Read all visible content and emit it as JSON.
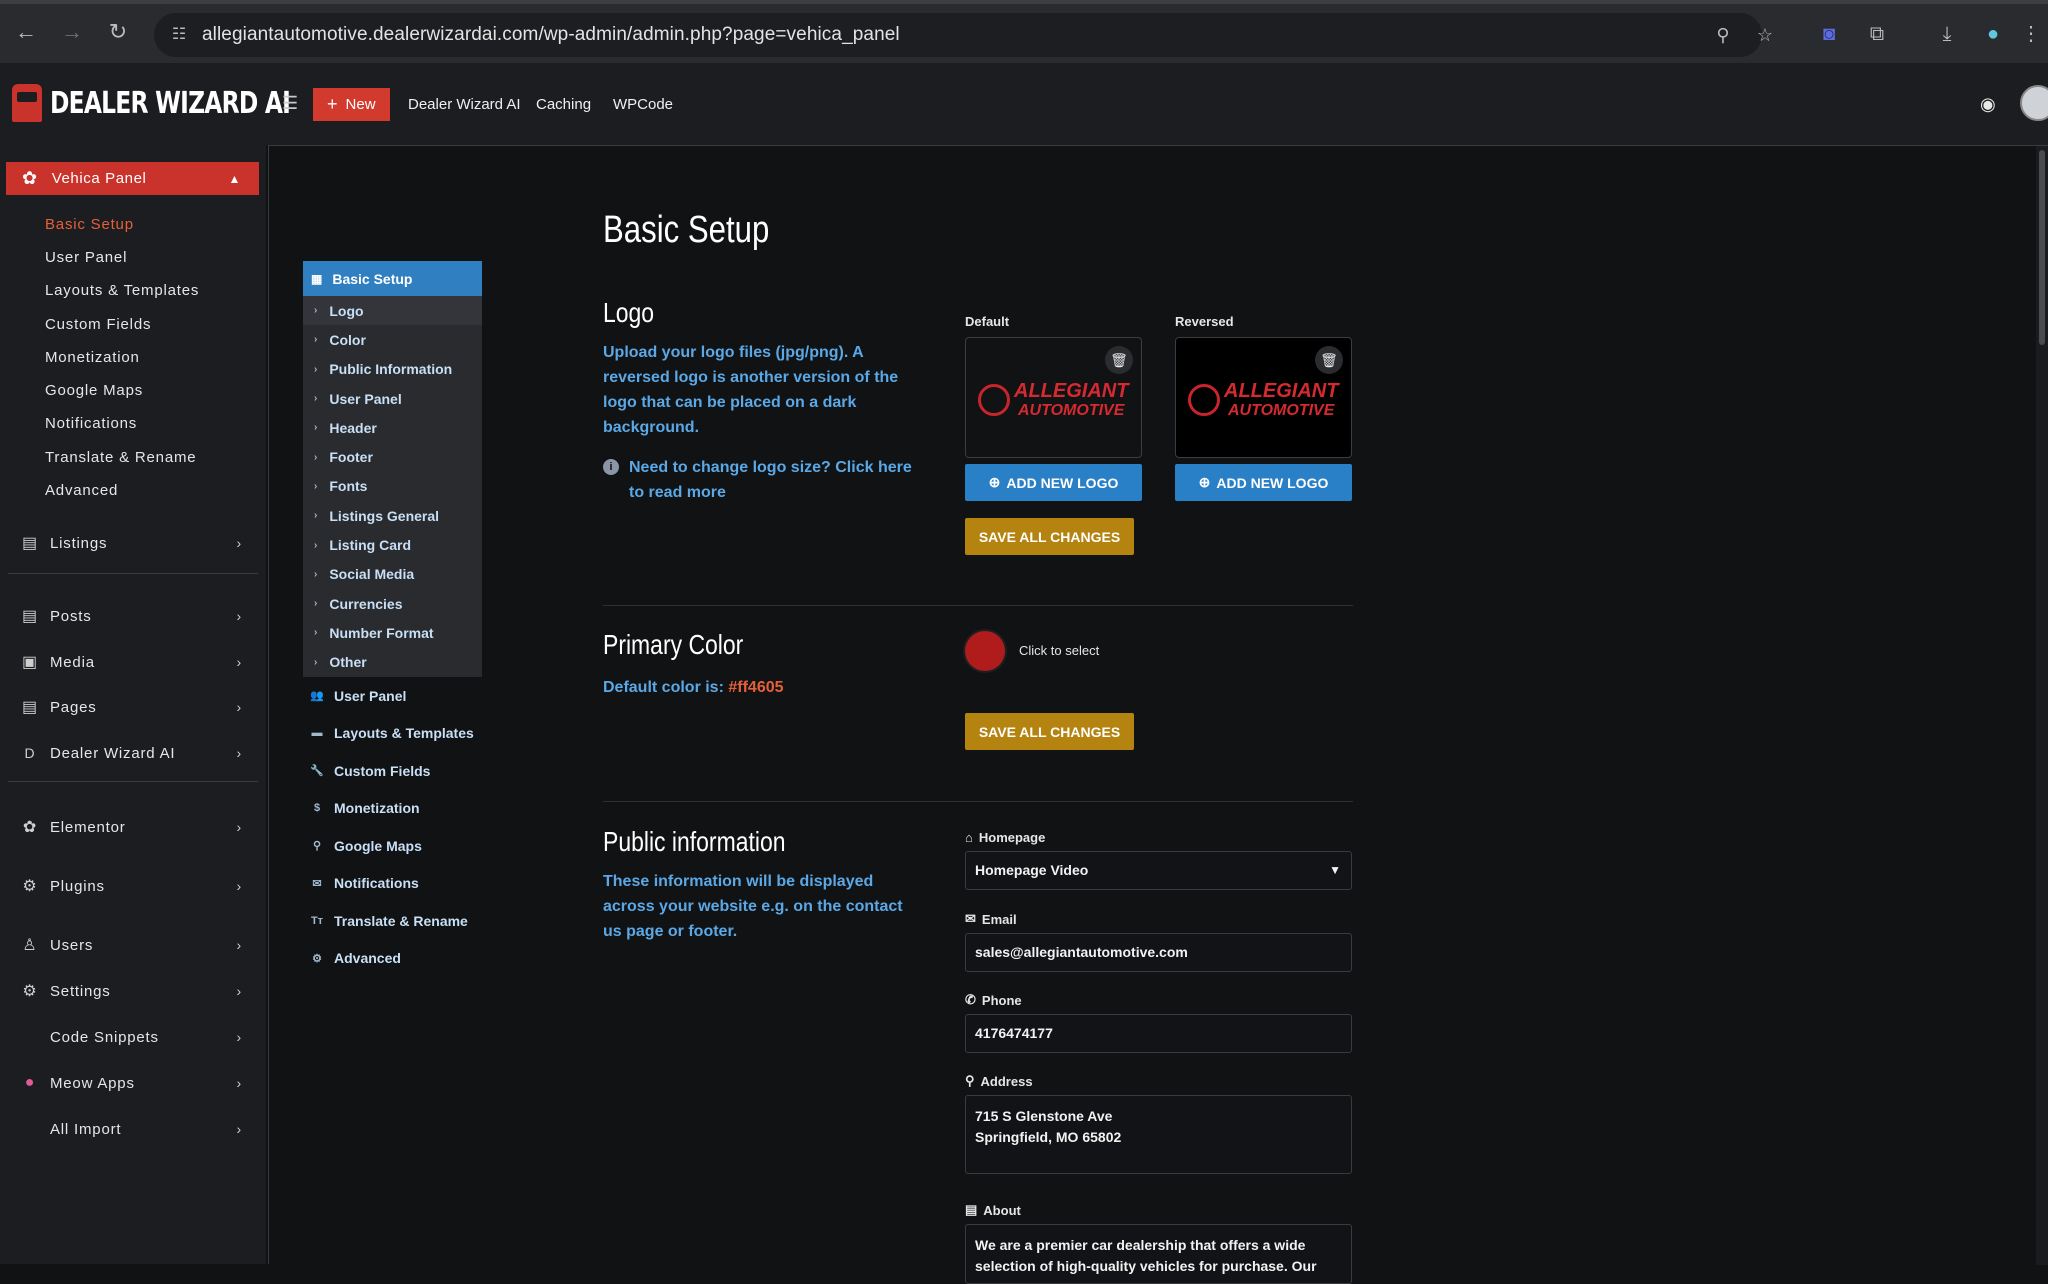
{
  "browser": {
    "url": "allegiantautomotive.dealerwizardai.com/wp-admin/admin.php?page=vehica_panel"
  },
  "adminbar": {
    "logo_text": "DEALER WIZARD AI",
    "new_label": "New",
    "menu": [
      "Dealer Wizard AI",
      "Caching",
      "WPCode"
    ]
  },
  "sidebar": {
    "panel_label": "Vehica Panel",
    "sub_items": [
      "Basic Setup",
      "User Panel",
      "Layouts & Templates",
      "Custom Fields",
      "Monetization",
      "Google Maps",
      "Notifications",
      "Translate & Rename",
      "Advanced"
    ],
    "menu": [
      "Listings",
      "Posts",
      "Media",
      "Pages",
      "Dealer Wizard AI",
      "Elementor",
      "Plugins",
      "Users",
      "Settings",
      "Code Snippets",
      "Meow Apps",
      "All Import"
    ],
    "dealer_letter": "D"
  },
  "inner_nav": {
    "head": "Basic Setup",
    "subs": [
      "Logo",
      "Color",
      "Public Information",
      "User Panel",
      "Header",
      "Footer",
      "Fonts",
      "Listings General",
      "Listing Card",
      "Social Media",
      "Currencies",
      "Number Format",
      "Other"
    ],
    "mains": [
      "User Panel",
      "Layouts & Templates",
      "Custom Fields",
      "Monetization",
      "Google Maps",
      "Notifications",
      "Translate & Rename",
      "Advanced"
    ]
  },
  "page": {
    "title": "Basic Setup",
    "logo": {
      "heading": "Logo",
      "description": "Upload your logo files (jpg/png). A reversed logo is another version of the logo that can be placed on a dark background.",
      "help_link": "Need to change logo size? Click here to read more",
      "default_label": "Default",
      "reversed_label": "Reversed",
      "logo_line1": "ALLEGIANT",
      "logo_line2": "AUTOMOTIVE",
      "add_new_logo": "ADD NEW LOGO",
      "save": "SAVE ALL CHANGES"
    },
    "primary_color": {
      "heading": "Primary Color",
      "default_prefix": "Default color is:",
      "default_value": "#ff4605",
      "swatch": "#b01b1b",
      "click_label": "Click to select",
      "save": "SAVE ALL CHANGES"
    },
    "public_info": {
      "heading": "Public information",
      "description": "These information will be displayed across your website e.g. on the contact us page or footer.",
      "homepage_label": "Homepage",
      "homepage_value": "Homepage Video",
      "email_label": "Email",
      "email_value": "sales@allegiantautomotive.com",
      "phone_label": "Phone",
      "phone_value": "4176474177",
      "address_label": "Address",
      "address_line1": "715 S Glenstone Ave",
      "address_line2": "Springfield, MO 65802",
      "about_label": "About",
      "about_value": "We are a premier car dealership that offers a wide selection of high-quality vehicles for purchase. Our"
    }
  },
  "colors": {
    "accent_red": "#c9332b",
    "link_blue": "#5aa8e6",
    "button_blue": "#2a80c7",
    "button_gold": "#b5830f",
    "highlight_orange": "#e5603a"
  }
}
